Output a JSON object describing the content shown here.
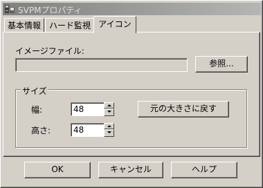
{
  "window": {
    "title": "SVPMプロパティ",
    "icon": "app-icon"
  },
  "tabs": [
    {
      "label": "基本情報",
      "active": false
    },
    {
      "label": "ハード監視",
      "active": false
    },
    {
      "label": "アイコン",
      "active": true
    }
  ],
  "image_file": {
    "label": "イメージファイル:",
    "value": "",
    "browse_label": "参照..."
  },
  "size_group": {
    "title": "サイズ",
    "width_label": "幅:",
    "width_value": "48",
    "height_label": "高さ:",
    "height_value": "48",
    "reset_label": "元の大きさに戻す"
  },
  "footer": {
    "ok_label": "OK",
    "cancel_label": "キャンセル",
    "help_label": "ヘルプ"
  },
  "colors": {
    "face": "#d4d0c8",
    "title_gradient_start": "#808080",
    "title_gradient_end": "#b5b5b5"
  }
}
